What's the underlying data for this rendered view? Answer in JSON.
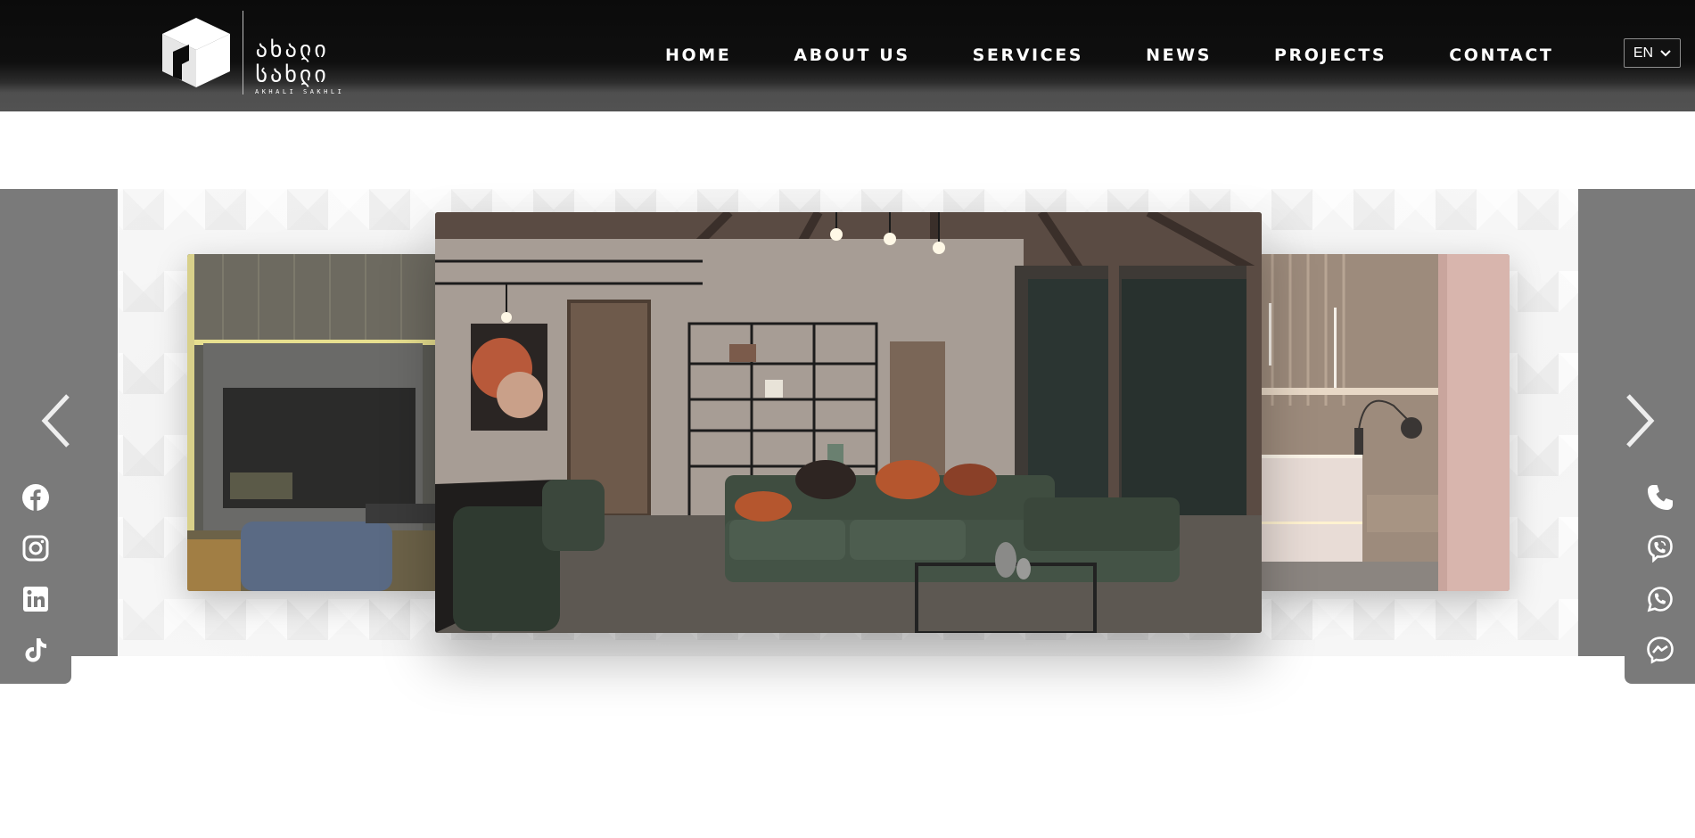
{
  "brand": {
    "name_main": "ახალი სახლი",
    "name_sub": "AKHALI SAKHLI"
  },
  "nav": {
    "items": [
      {
        "id": "home",
        "label": "HOME"
      },
      {
        "id": "about",
        "label": "ABOUT US"
      },
      {
        "id": "services",
        "label": "SERVICES"
      },
      {
        "id": "news",
        "label": "NEWS"
      },
      {
        "id": "projects",
        "label": "PROJECTS"
      },
      {
        "id": "contact",
        "label": "CONTACT"
      }
    ]
  },
  "language": {
    "selected": "EN",
    "icon": "chevron-down-icon"
  },
  "slider": {
    "slides": [
      {
        "position": "previous",
        "scene": "living room with wall-mounted TV"
      },
      {
        "position": "current",
        "scene": "living room with green sectional sofa and black metal shelving"
      },
      {
        "position": "next",
        "scene": "bedroom with wood panel wall and lamp"
      }
    ],
    "prev_icon": "chevron-left-icon",
    "next_icon": "chevron-right-icon"
  },
  "social_links": [
    {
      "id": "facebook",
      "icon": "facebook-icon"
    },
    {
      "id": "instagram",
      "icon": "instagram-icon"
    },
    {
      "id": "linkedin",
      "icon": "linkedin-icon"
    },
    {
      "id": "tiktok",
      "icon": "tiktok-icon"
    }
  ],
  "contact_links": [
    {
      "id": "phone",
      "icon": "phone-icon"
    },
    {
      "id": "viber",
      "icon": "viber-icon"
    },
    {
      "id": "whatsapp",
      "icon": "whatsapp-icon"
    },
    {
      "id": "messenger",
      "icon": "messenger-icon"
    }
  ],
  "colors": {
    "header_bg": "#0b0b0b",
    "panel_bg": "#7a7a7a",
    "text_light": "#ffffff",
    "sofa_green": "#3f4d40",
    "pillow_orange": "#b5562e"
  }
}
